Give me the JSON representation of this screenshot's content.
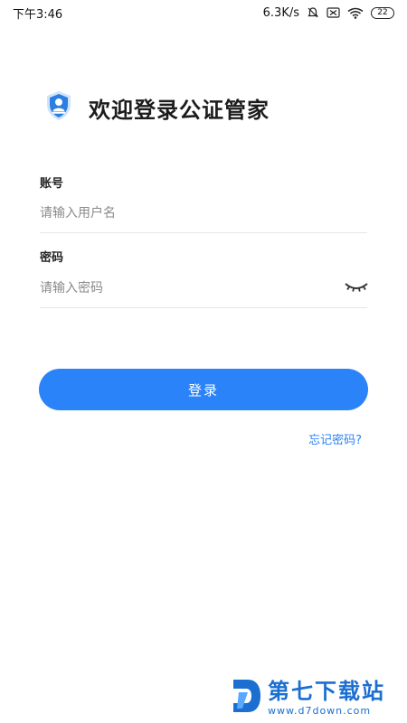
{
  "status_bar": {
    "time": "下午3:46",
    "network_speed": "6.3K/s",
    "battery": "22",
    "icons": [
      "bell-muted-icon",
      "sim-icon",
      "wifi-icon",
      "battery-icon"
    ]
  },
  "header": {
    "logo_icon": "shield-user-icon",
    "title": "欢迎登录公证管家"
  },
  "form": {
    "account": {
      "label": "账号",
      "placeholder": "请输入用户名",
      "value": ""
    },
    "password": {
      "label": "密码",
      "placeholder": "请输入密码",
      "value": "",
      "toggle_icon": "eye-closed-icon"
    },
    "submit_label": "登录",
    "forgot_label": "忘记密码?"
  },
  "watermark": {
    "name": "第七下载站",
    "url": "www.d7down.com",
    "logo_icon": "d7-logo-icon"
  },
  "colors": {
    "primary": "#2a83f8",
    "watermark": "#1b6fd1",
    "text": "#222222",
    "placeholder": "#8a8a8a",
    "divider": "#e6e6e6"
  }
}
